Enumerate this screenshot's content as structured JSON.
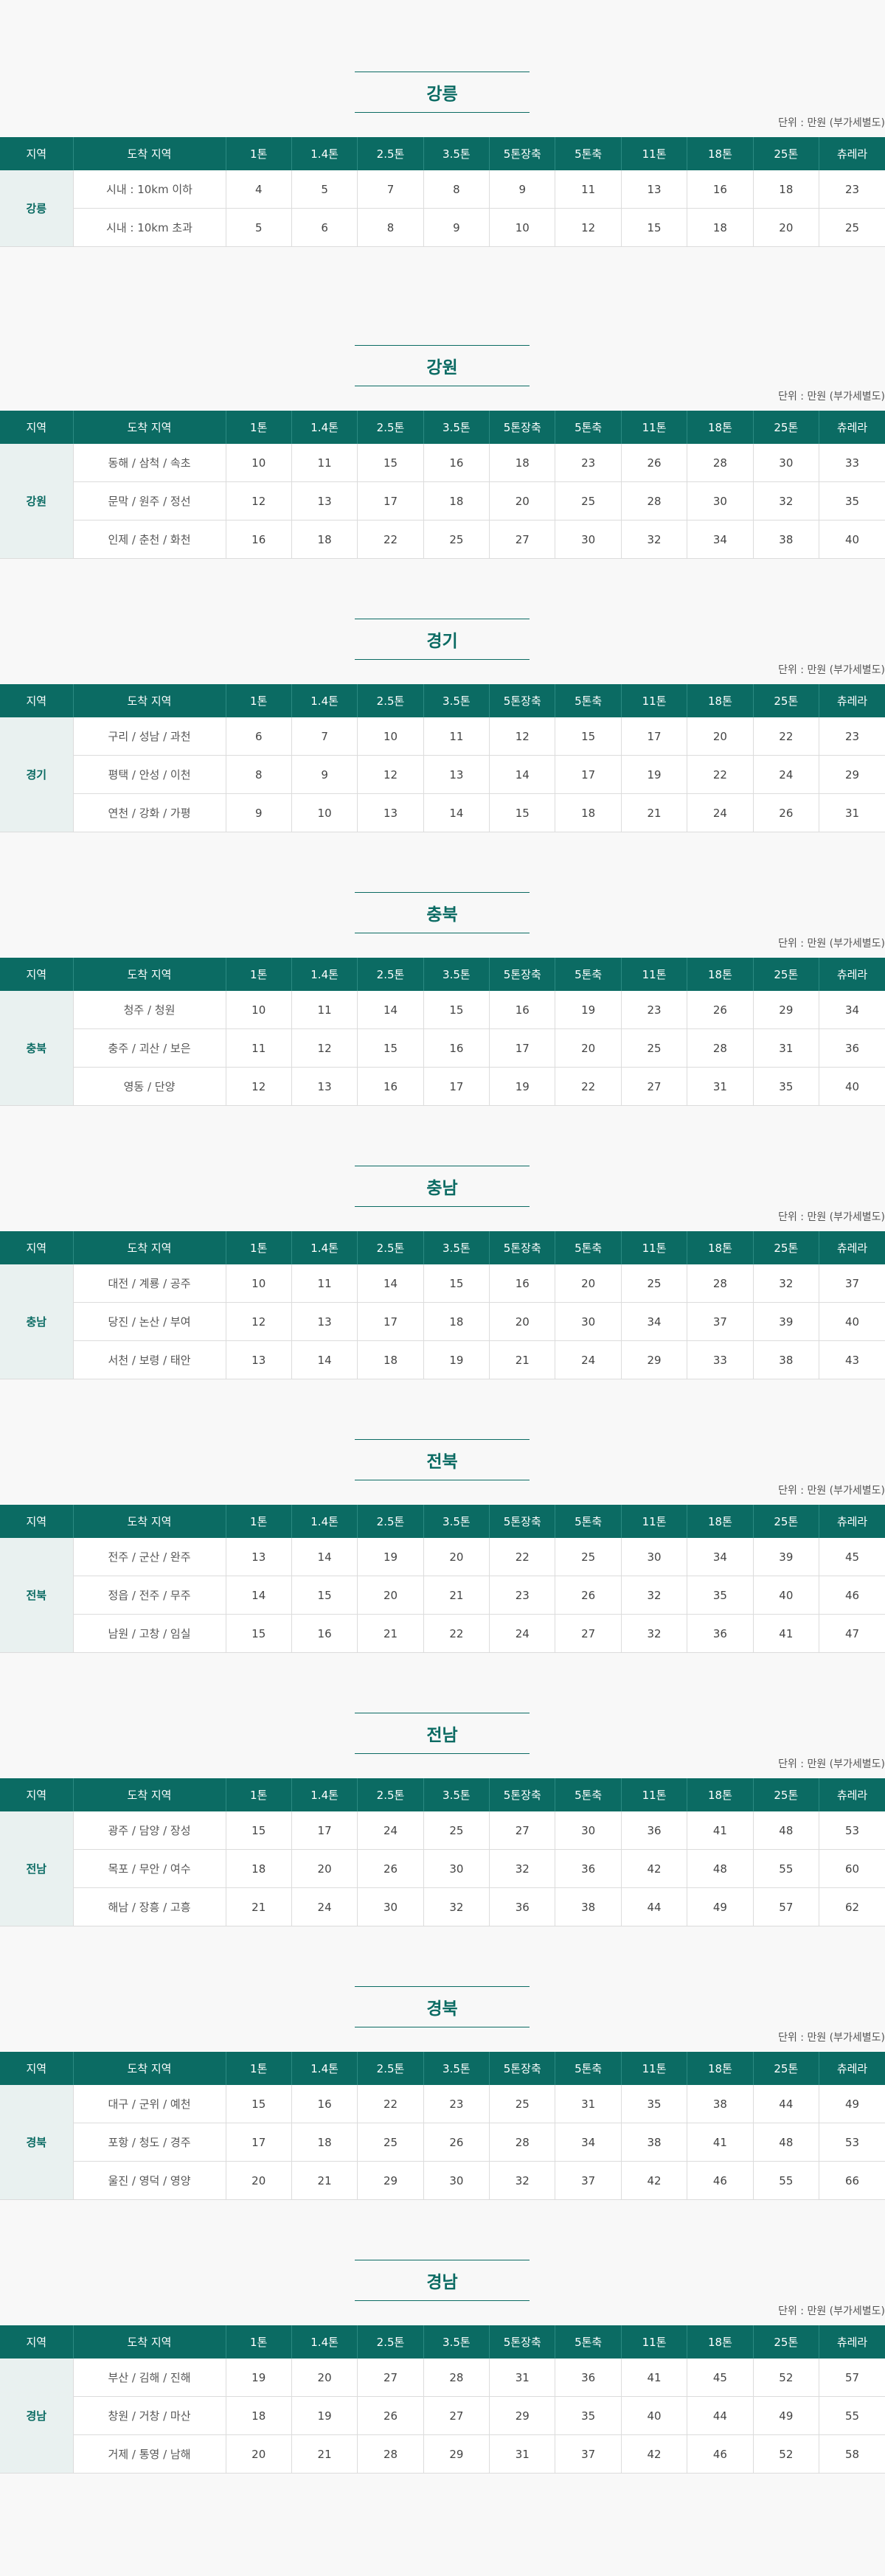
{
  "unit_note": "단위 : 만원 (부가세별도)",
  "headers": [
    "지역",
    "도착 지역",
    "1톤",
    "1.4톤",
    "2.5톤",
    "3.5톤",
    "5톤장축",
    "5톤축",
    "11톤",
    "18톤",
    "25톤",
    "츄레라"
  ],
  "sections": [
    {
      "title": "강릉",
      "region": "강릉",
      "rows": [
        {
          "dest": "시내 : 10km 이하",
          "values": [
            "4",
            "5",
            "7",
            "8",
            "9",
            "11",
            "13",
            "16",
            "18",
            "23"
          ]
        },
        {
          "dest": "시내 : 10km 초과",
          "values": [
            "5",
            "6",
            "8",
            "9",
            "10",
            "12",
            "15",
            "18",
            "20",
            "25"
          ]
        }
      ]
    },
    {
      "title": "강원",
      "region": "강원",
      "rows": [
        {
          "dest": "동해 / 삼척 / 속초",
          "values": [
            "10",
            "11",
            "15",
            "16",
            "18",
            "23",
            "26",
            "28",
            "30",
            "33"
          ]
        },
        {
          "dest": "문막 / 원주 / 정선",
          "values": [
            "12",
            "13",
            "17",
            "18",
            "20",
            "25",
            "28",
            "30",
            "32",
            "35"
          ]
        },
        {
          "dest": "인제 / 춘천 / 화천",
          "values": [
            "16",
            "18",
            "22",
            "25",
            "27",
            "30",
            "32",
            "34",
            "38",
            "40"
          ]
        }
      ]
    },
    {
      "title": "경기",
      "region": "경기",
      "rows": [
        {
          "dest": "구리 / 성남 / 과천",
          "values": [
            "6",
            "7",
            "10",
            "11",
            "12",
            "15",
            "17",
            "20",
            "22",
            "23"
          ]
        },
        {
          "dest": "평택 / 안성 / 이천",
          "values": [
            "8",
            "9",
            "12",
            "13",
            "14",
            "17",
            "19",
            "22",
            "24",
            "29"
          ]
        },
        {
          "dest": "연천 / 강화 / 가평",
          "values": [
            "9",
            "10",
            "13",
            "14",
            "15",
            "18",
            "21",
            "24",
            "26",
            "31"
          ]
        }
      ]
    },
    {
      "title": "충북",
      "region": "충북",
      "rows": [
        {
          "dest": "청주 / 청원",
          "values": [
            "10",
            "11",
            "14",
            "15",
            "16",
            "19",
            "23",
            "26",
            "29",
            "34"
          ]
        },
        {
          "dest": "충주 / 괴산 / 보은",
          "values": [
            "11",
            "12",
            "15",
            "16",
            "17",
            "20",
            "25",
            "28",
            "31",
            "36"
          ]
        },
        {
          "dest": "영동 / 단양",
          "values": [
            "12",
            "13",
            "16",
            "17",
            "19",
            "22",
            "27",
            "31",
            "35",
            "40"
          ]
        }
      ]
    },
    {
      "title": "충남",
      "region": "충남",
      "rows": [
        {
          "dest": "대전 / 계룡 / 공주",
          "values": [
            "10",
            "11",
            "14",
            "15",
            "16",
            "20",
            "25",
            "28",
            "32",
            "37"
          ]
        },
        {
          "dest": "당진 / 논산 / 부여",
          "values": [
            "12",
            "13",
            "17",
            "18",
            "20",
            "30",
            "34",
            "37",
            "39",
            "40"
          ]
        },
        {
          "dest": "서천 / 보령 / 태안",
          "values": [
            "13",
            "14",
            "18",
            "19",
            "21",
            "24",
            "29",
            "33",
            "38",
            "43"
          ]
        }
      ]
    },
    {
      "title": "전북",
      "region": "전북",
      "rows": [
        {
          "dest": "전주 / 군산 / 완주",
          "values": [
            "13",
            "14",
            "19",
            "20",
            "22",
            "25",
            "30",
            "34",
            "39",
            "45"
          ]
        },
        {
          "dest": "정읍 / 전주 / 무주",
          "values": [
            "14",
            "15",
            "20",
            "21",
            "23",
            "26",
            "32",
            "35",
            "40",
            "46"
          ]
        },
        {
          "dest": "남원 / 고창 / 임실",
          "values": [
            "15",
            "16",
            "21",
            "22",
            "24",
            "27",
            "32",
            "36",
            "41",
            "47"
          ]
        }
      ]
    },
    {
      "title": "전남",
      "region": "전남",
      "rows": [
        {
          "dest": "광주 / 담양 / 장성",
          "values": [
            "15",
            "17",
            "24",
            "25",
            "27",
            "30",
            "36",
            "41",
            "48",
            "53"
          ]
        },
        {
          "dest": "목포 / 무안 / 여수",
          "values": [
            "18",
            "20",
            "26",
            "30",
            "32",
            "36",
            "42",
            "48",
            "55",
            "60"
          ]
        },
        {
          "dest": "해남 / 장흥 / 고흥",
          "values": [
            "21",
            "24",
            "30",
            "32",
            "36",
            "38",
            "44",
            "49",
            "57",
            "62"
          ]
        }
      ]
    },
    {
      "title": "경북",
      "region": "경북",
      "rows": [
        {
          "dest": "대구 / 군위 / 예천",
          "values": [
            "15",
            "16",
            "22",
            "23",
            "25",
            "31",
            "35",
            "38",
            "44",
            "49"
          ]
        },
        {
          "dest": "포항 / 청도 / 경주",
          "values": [
            "17",
            "18",
            "25",
            "26",
            "28",
            "34",
            "38",
            "41",
            "48",
            "53"
          ]
        },
        {
          "dest": "울진 / 영덕 / 영양",
          "values": [
            "20",
            "21",
            "29",
            "30",
            "32",
            "37",
            "42",
            "46",
            "55",
            "66"
          ]
        }
      ]
    },
    {
      "title": "경남",
      "region": "경남",
      "rows": [
        {
          "dest": "부산 / 김해 / 진해",
          "values": [
            "19",
            "20",
            "27",
            "28",
            "31",
            "36",
            "41",
            "45",
            "52",
            "57"
          ]
        },
        {
          "dest": "창원 / 거창 / 마산",
          "values": [
            "18",
            "19",
            "26",
            "27",
            "29",
            "35",
            "40",
            "44",
            "49",
            "55"
          ]
        },
        {
          "dest": "거제 / 통영 / 남해",
          "values": [
            "20",
            "21",
            "28",
            "29",
            "31",
            "37",
            "42",
            "46",
            "52",
            "58"
          ]
        }
      ]
    }
  ]
}
